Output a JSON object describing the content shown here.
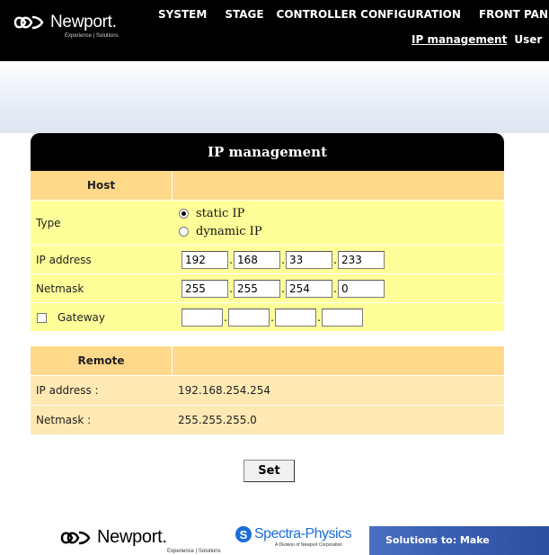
{
  "header": {
    "brand": "Newport.",
    "brand_tagline": "Experience | Solutions",
    "nav": [
      "SYSTEM",
      "STAGE",
      "CONTROLLER CONFIGURATION",
      "FRONT PANE"
    ],
    "subnav": [
      "IP management",
      "User"
    ]
  },
  "panel": {
    "title": "IP management",
    "host": {
      "header": "Host",
      "type_label": "Type",
      "type_options": [
        "static IP",
        "dynamic IP"
      ],
      "type_selected": "static IP",
      "ip_label": "IP address",
      "ip_octets": [
        "192",
        "168",
        "33",
        "233"
      ],
      "netmask_label": "Netmask",
      "netmask_octets": [
        "255",
        "255",
        "254",
        "0"
      ],
      "gateway_label": "Gateway",
      "gateway_octets": [
        "",
        "",
        "",
        ""
      ],
      "gateway_checked": false
    },
    "remote": {
      "header": "Remote",
      "ip_label": "IP address :",
      "ip_value": "192.168.254.254",
      "netmask_label": "Netmask :",
      "netmask_value": "255.255.255.0"
    },
    "set_label": "Set"
  },
  "footer": {
    "newport": "Newport.",
    "newport_tagline": "Experience | Solutions",
    "spectra": "Spectra-Physics",
    "spectra_tagline": "A Division of Newport Corporation",
    "banner_text": "Solutions to: Make"
  },
  "colors": {
    "header_bg": "#000000",
    "host_header": "#ffd98a",
    "host_row": "#ffff99",
    "remote_row": "#ffe9b3",
    "spectra_blue": "#1a6ed8"
  }
}
